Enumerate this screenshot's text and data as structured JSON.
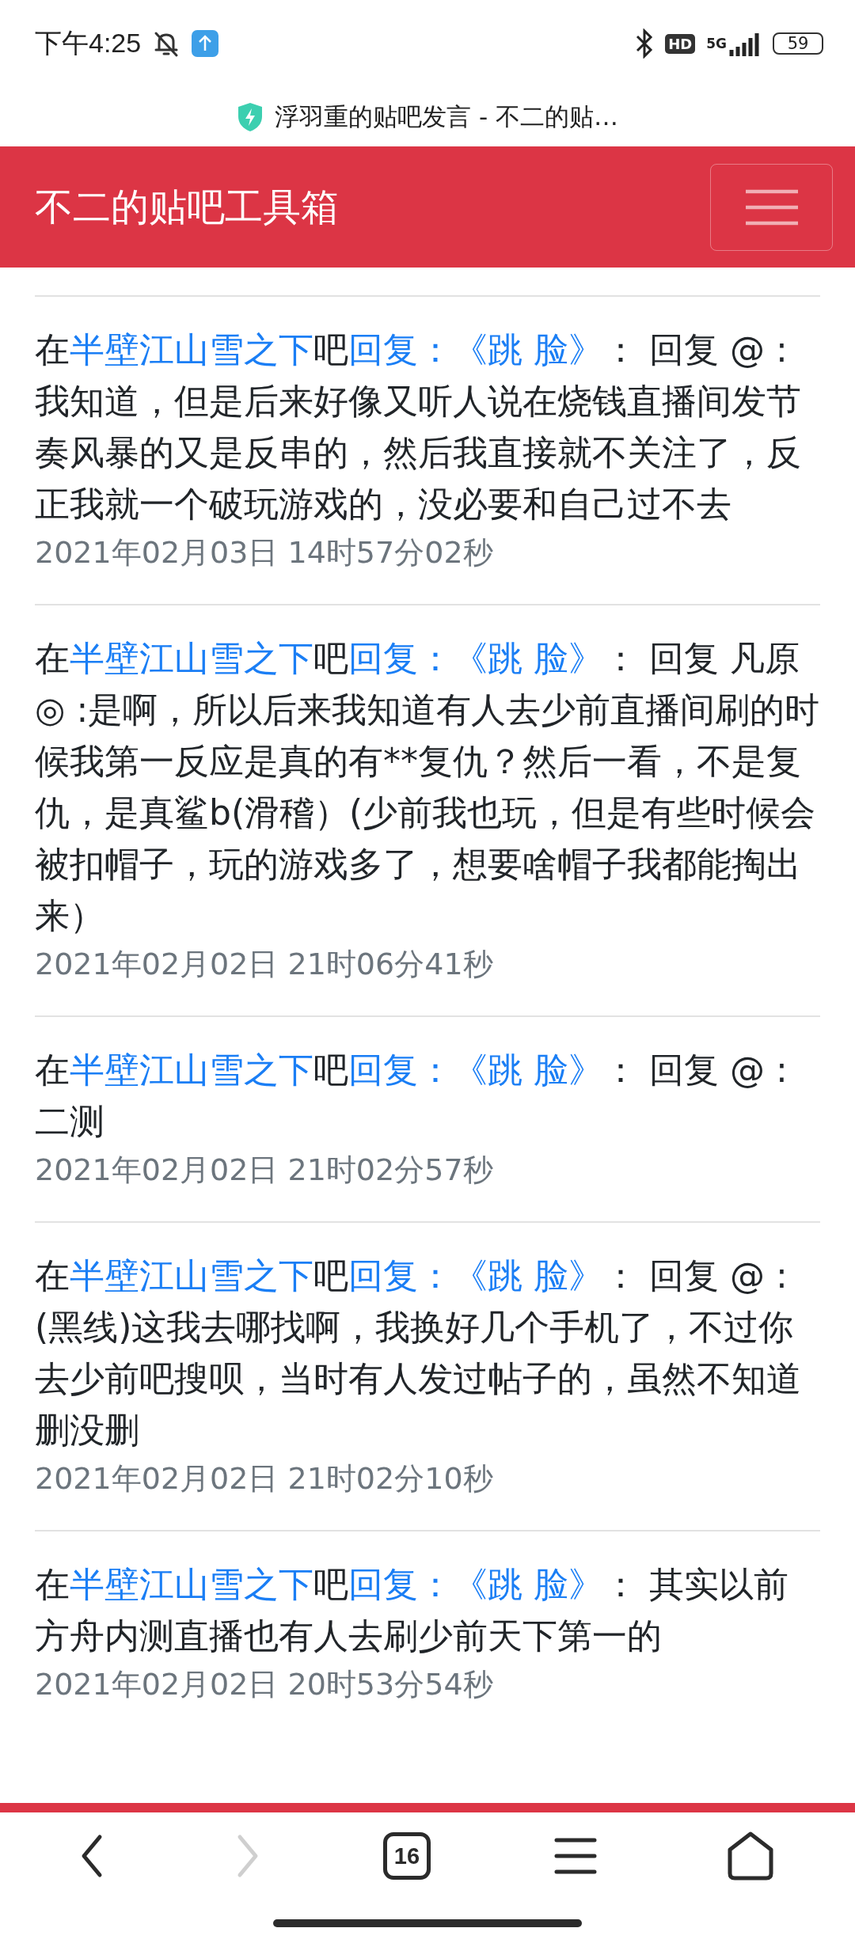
{
  "status_bar": {
    "time": "下午4:25",
    "network": "5G",
    "hd": "HD",
    "battery": "59"
  },
  "browser": {
    "page_title": "浮羽重的贴吧发言 - 不二的贴…"
  },
  "navbar": {
    "brand": "不二的贴吧工具箱"
  },
  "posts": [
    {
      "prefix": "在",
      "forum": "半壁江山雪之下",
      "suffix": "吧",
      "thread": "回复：《跳 脸》",
      "body": "： 回复 @ :我知道，但是后来好像又听人说在烧钱直播间发节奏风暴的又是反串的，然后我直接就不关注了，反正我就一个破玩游戏的，没必要和自己过不去",
      "time": "2021年02月03日 14时57分02秒"
    },
    {
      "prefix": "在",
      "forum": "半壁江山雪之下",
      "suffix": "吧",
      "thread": "回复：《跳 脸》",
      "body": "： 回复 凡原◎ :是啊，所以后来我知道有人去少前直播间刷的时候我第一反应是真的有**复仇？然后一看，不是复仇，是真鲨b(滑稽）(少前我也玩，但是有些时候会被扣帽子，玩的游戏多了，想要啥帽子我都能掏出来）",
      "time": "2021年02月02日 21时06分41秒"
    },
    {
      "prefix": "在",
      "forum": "半壁江山雪之下",
      "suffix": "吧",
      "thread": "回复：《跳 脸》",
      "body": "： 回复 @ :二测",
      "time": "2021年02月02日 21时02分57秒"
    },
    {
      "prefix": "在",
      "forum": "半壁江山雪之下",
      "suffix": "吧",
      "thread": "回复：《跳 脸》",
      "body": "： 回复 @ :(黑线)这我去哪找啊，我换好几个手机了，不过你去少前吧搜呗，当时有人发过帖子的，虽然不知道删没删",
      "time": "2021年02月02日 21时02分10秒"
    },
    {
      "prefix": "在",
      "forum": "半壁江山雪之下",
      "suffix": "吧",
      "thread": "回复：《跳 脸》",
      "body": "： 其实以前方舟内测直播也有人去刷少前天下第一的",
      "time": "2021年02月02日 20时53分54秒"
    }
  ],
  "bottom_nav": [
    {
      "kind": "back",
      "disabled": false
    },
    {
      "kind": "forward",
      "disabled": true
    },
    {
      "kind": "tabs",
      "label": "16",
      "disabled": false
    },
    {
      "kind": "menu",
      "disabled": false
    },
    {
      "kind": "home",
      "disabled": false
    }
  ]
}
